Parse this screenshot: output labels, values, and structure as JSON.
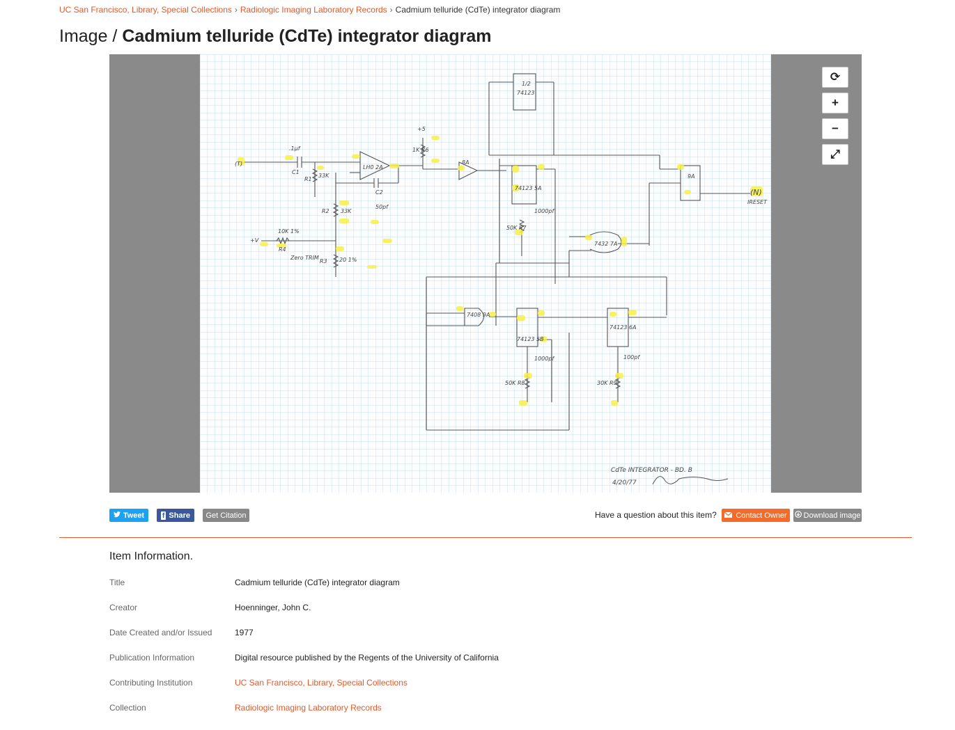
{
  "breadcrumb": {
    "items": [
      "UC San Francisco, Library, Special Collections",
      "Radiologic Imaging Laboratory Records"
    ],
    "current": "Cadmium telluride (CdTe) integrator diagram",
    "separator": "›"
  },
  "page": {
    "title_prefix": "Image /",
    "title": "Cadmium telluride (CdTe) integrator diagram"
  },
  "viewer": {
    "controls": [
      {
        "name": "rotate",
        "glyph": "⟳"
      },
      {
        "name": "zoom-in",
        "glyph": "+"
      },
      {
        "name": "zoom-out",
        "glyph": "−"
      },
      {
        "name": "fullscreen",
        "glyph": "⤢"
      }
    ],
    "schematic_labels": {
      "cap1": ".1μf",
      "c1": "C1",
      "r1": "R1",
      "r1_val": "33K",
      "opamp": "LH0 2A",
      "c2": "C2",
      "c2_val": "50pf",
      "r2": "R2",
      "r2_val": "33K",
      "r4_val": "10K 1%",
      "r4": "R4",
      "vin": "+V",
      "zero": "Zero TRIM",
      "r3": "R3",
      "r3_val": "20 1%",
      "plus5": "+5",
      "r6": "1K R6",
      "buf": "8A",
      "top_ic": "74123",
      "top_half": "1/2",
      "ic_5a": "74123 5A",
      "ic_5b": "74123 5B",
      "and_7a": "7432 7A",
      "and_9a": "7408 9A",
      "ff_9a": "9A",
      "ic_6a": "74123 6A",
      "r9": "30K R9",
      "r8": "50K R8",
      "r7": "50K R7",
      "c4": "1000pf",
      "c5": "100pf",
      "c3": "1000pf",
      "out": "(N)",
      "reset": "IRESET",
      "input": "(T)"
    },
    "caption_line1": "CdTe INTEGRATOR - BD. B",
    "caption_line2": "4/20/77"
  },
  "share": {
    "tweet": "Tweet",
    "facebook": "Share",
    "citation": "Get Citation",
    "question": "Have a question about this item?",
    "contact": "Contact Owner",
    "download": "Download image"
  },
  "item_info": {
    "heading": "Item Information.",
    "rows": [
      {
        "label": "Title",
        "value": "Cadmium telluride (CdTe) integrator diagram",
        "link": false
      },
      {
        "label": "Creator",
        "value": "Hoenninger, John C.",
        "link": false
      },
      {
        "label": "Date Created and/or Issued",
        "value": "1977",
        "link": false
      },
      {
        "label": "Publication Information",
        "value": "Digital resource published by the Regents of the University of California",
        "link": false
      },
      {
        "label": "Contributing Institution",
        "value": "UC San Francisco, Library, Special Collections",
        "link": true
      },
      {
        "label": "Collection",
        "value": "Radiologic Imaging Laboratory Records",
        "link": true
      }
    ]
  }
}
